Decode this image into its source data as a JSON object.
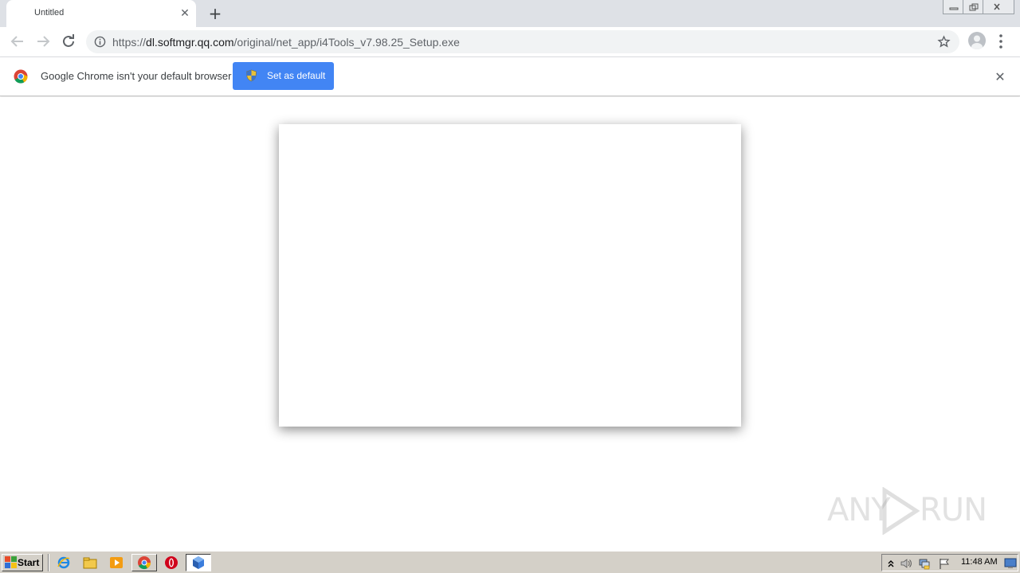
{
  "browser": {
    "tab": {
      "title": "Untitled",
      "close_glyph": "✕"
    },
    "new_tab_glyph": "+",
    "window_controls": [
      "minimize-icon",
      "restore-icon",
      "close-icon"
    ],
    "url": {
      "scheme": "https://",
      "host": "dl.softmgr.qq.com",
      "path": "/original/net_app/i4Tools_v7.98.25_Setup.exe"
    }
  },
  "infobar": {
    "message": "Google Chrome isn't your default browser",
    "button_label": "Set as default",
    "close_glyph": "✕"
  },
  "watermark": {
    "left": "ANY",
    "right": "RUN"
  },
  "taskbar": {
    "start_label": "Start",
    "quick_launch": [
      "ie-icon",
      "explorer-icon",
      "media-player-icon"
    ],
    "tasks": [
      "chrome-icon",
      "opera-icon",
      "installer-icon"
    ],
    "tray_icons": [
      "tray-expand-icon",
      "volume-icon",
      "network-icon",
      "action-center-flag-icon"
    ],
    "clock": "11:48 AM"
  },
  "colors": {
    "accent": "#4285f4",
    "tabstrip": "#dee1e6",
    "taskbar": "#d4d0c8"
  }
}
